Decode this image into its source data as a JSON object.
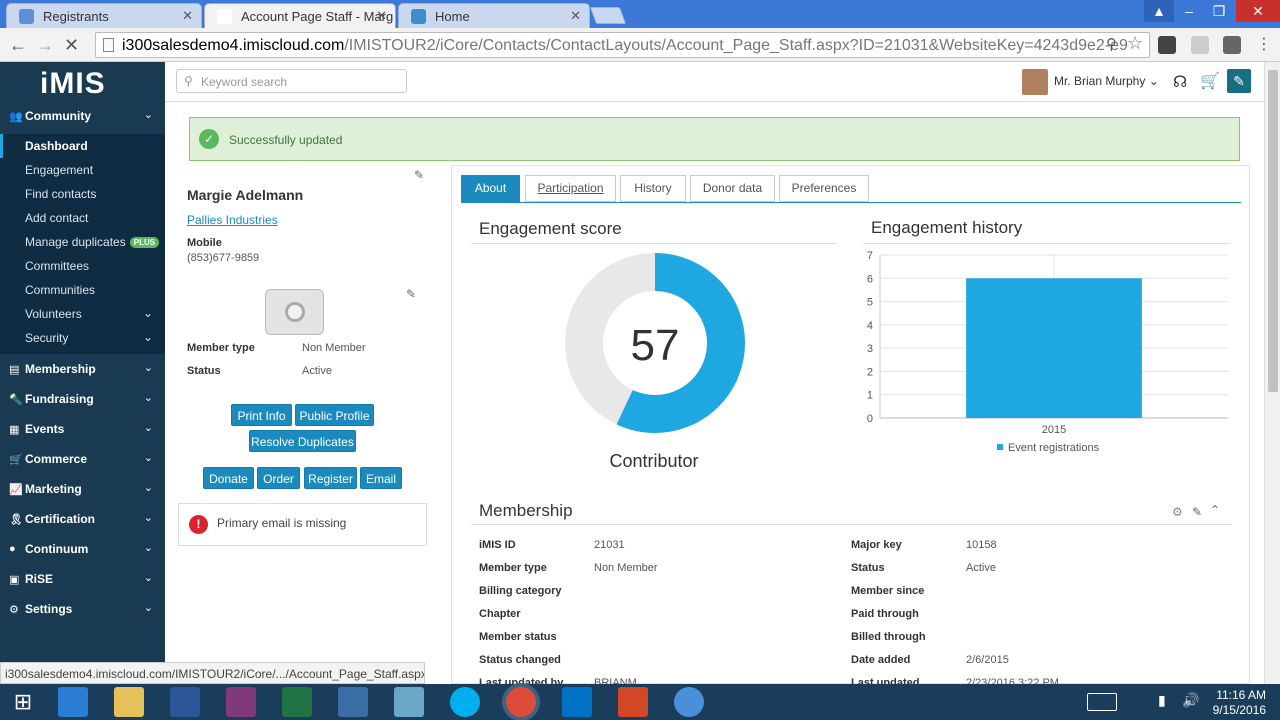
{
  "browser": {
    "tabs": [
      {
        "title": "Registrants",
        "icon_color": "#5b8fd6"
      },
      {
        "title": "Account Page Staff - Marg",
        "icon_color": "#ffffff"
      },
      {
        "title": "Home",
        "icon_color": "#3b8ec9"
      }
    ],
    "url_host": "i300salesdemo4.imiscloud.com",
    "url_path": "/IMISTOUR2/iCore/Contacts/ContactLayouts/Account_Page_Staff.aspx?ID=21031&WebsiteKey=4243d9e2-e9",
    "status_url": "i300salesdemo4.imiscloud.com/IMISTOUR2/iCore/.../Account_Page_Staff.aspx..."
  },
  "sidebar": {
    "logo": "iMIS",
    "community": {
      "label": "Community",
      "items": [
        "Dashboard",
        "Engagement",
        "Find contacts",
        "Add contact",
        "Manage duplicates",
        "Committees",
        "Communities",
        "Volunteers",
        "Security"
      ],
      "plus_badge": "PLUS"
    },
    "sections": [
      "Membership",
      "Fundraising",
      "Events",
      "Commerce",
      "Marketing",
      "Certification",
      "Continuum",
      "RiSE",
      "Settings"
    ]
  },
  "header": {
    "search_placeholder": "Keyword search",
    "user_name": "Mr. Brian Murphy"
  },
  "alert": {
    "message": "Successfully updated",
    "color": "#dff0d8"
  },
  "contact": {
    "name": "Margie Adelmann",
    "company": "Pallies Industries",
    "phone_label": "Mobile",
    "phone": "(853)677-9859",
    "member_type_label": "Member type",
    "member_type": "Non Member",
    "status_label": "Status",
    "status": "Active",
    "buttons": {
      "print": "Print Info",
      "public": "Public Profile",
      "resolve": "Resolve Duplicates",
      "donate": "Donate",
      "order": "Order",
      "register": "Register",
      "email": "Email"
    },
    "warning": "Primary email is missing"
  },
  "tabs": [
    "About",
    "Participation",
    "History",
    "Donor data",
    "Preferences"
  ],
  "engagement": {
    "title": "Engagement score",
    "score": "57",
    "level": "Contributor",
    "score_fraction": 0.57,
    "ring_color": "#1ea7e1"
  },
  "history": {
    "title": "Engagement history"
  },
  "chart_data": {
    "type": "bar",
    "categories": [
      "2015"
    ],
    "series": [
      {
        "name": "Event registrations",
        "values": [
          6
        ]
      }
    ],
    "ylim": [
      0,
      7
    ],
    "yticks": [
      "0",
      "1",
      "2",
      "3",
      "4",
      "5",
      "6",
      "7"
    ],
    "legend_position": "bottom",
    "bar_color": "#1ea7e1",
    "grid": true
  },
  "membership": {
    "title": "Membership",
    "left": [
      {
        "label": "iMIS ID",
        "value": "21031"
      },
      {
        "label": "Member type",
        "value": "Non Member"
      },
      {
        "label": "Billing category",
        "value": ""
      },
      {
        "label": "Chapter",
        "value": ""
      },
      {
        "label": "Member status",
        "value": ""
      },
      {
        "label": "Status changed",
        "value": ""
      },
      {
        "label": "Last updated by",
        "value": "BRIANM"
      }
    ],
    "right": [
      {
        "label": "Major key",
        "value": "10158"
      },
      {
        "label": "Status",
        "value": "Active"
      },
      {
        "label": "Member since",
        "value": ""
      },
      {
        "label": "Paid through",
        "value": ""
      },
      {
        "label": "Billed through",
        "value": ""
      },
      {
        "label": "Date added",
        "value": "2/6/2015"
      },
      {
        "label": "Last updated",
        "value": "2/23/2016 3:22 PM"
      }
    ]
  },
  "taskbar": {
    "time": "11:16 AM",
    "date": "9/15/2016"
  }
}
